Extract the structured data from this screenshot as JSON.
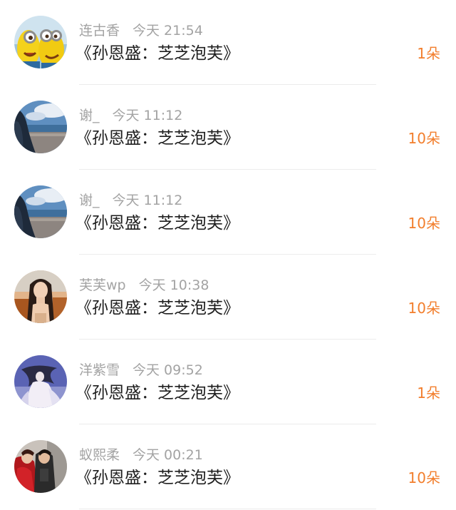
{
  "records": [
    {
      "name": "连古香",
      "time": "今天 21:54",
      "content": "《孙恩盛：芝芝泡芙》",
      "gift": "1朵",
      "avatar": "minion-avatar"
    },
    {
      "name": "谢_",
      "time": "今天 11:12",
      "content": "《孙恩盛：芝芝泡芙》",
      "gift": "10朵",
      "avatar": "beach-avatar"
    },
    {
      "name": "谢_",
      "time": "今天 11:12",
      "content": "《孙恩盛：芝芝泡芙》",
      "gift": "10朵",
      "avatar": "beach-avatar"
    },
    {
      "name": "芙芙wp",
      "time": "今天 10:38",
      "content": "《孙恩盛：芝芝泡芙》",
      "gift": "10朵",
      "avatar": "girl-photo-avatar"
    },
    {
      "name": "洋紫雪",
      "time": "今天 09:52",
      "content": "《孙恩盛：芝芝泡芙》",
      "gift": "1朵",
      "avatar": "illustration-avatar"
    },
    {
      "name": "蚁熙柔",
      "time": "今天 00:21",
      "content": "《孙恩盛：芝芝泡芙》",
      "gift": "10朵",
      "avatar": "couple-photo-avatar"
    }
  ],
  "colors": {
    "gift_accent": "#f27e2c",
    "meta_text": "#a3a3a3",
    "body_text": "#1f1f1f",
    "divider": "#ececec"
  }
}
